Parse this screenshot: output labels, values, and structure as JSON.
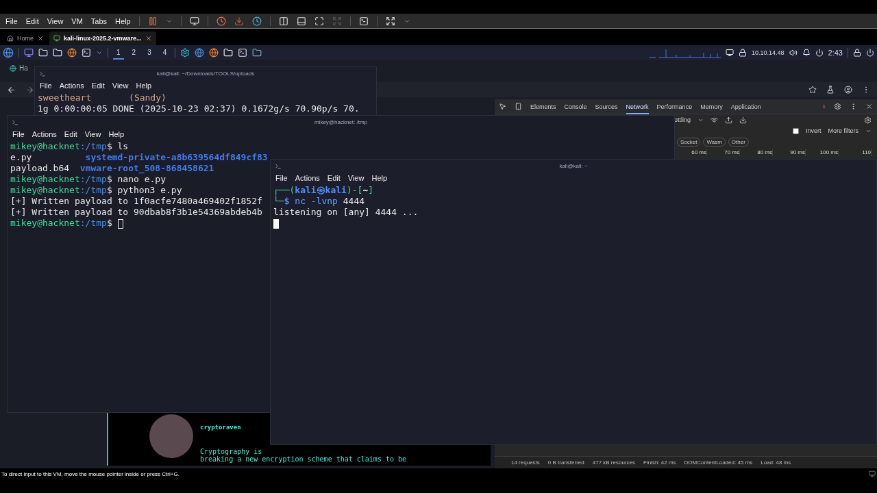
{
  "vm_menu": [
    "File",
    "Edit",
    "View",
    "VM",
    "Tabs",
    "Help"
  ],
  "vm_tabs": [
    {
      "label": "Home",
      "selected": false
    },
    {
      "label": "kali-linux-2025.2-vmware...",
      "selected": true
    }
  ],
  "panel": {
    "workspaces": [
      {
        "label": "1",
        "selected": true
      },
      {
        "label": "2",
        "selected": false
      },
      {
        "label": "3",
        "selected": false
      },
      {
        "label": "4",
        "selected": false
      }
    ],
    "ip": "10.10.14.48",
    "clock": "2:43"
  },
  "browser": {
    "tab": "Ha"
  },
  "devtools": {
    "tabs": [
      {
        "label": "Elements",
        "selected": false
      },
      {
        "label": "Console",
        "selected": false
      },
      {
        "label": "Sources",
        "selected": false
      },
      {
        "label": "Network",
        "selected": true
      },
      {
        "label": "Performance",
        "selected": false
      },
      {
        "label": "Memory",
        "selected": false
      },
      {
        "label": "Application",
        "selected": false
      }
    ],
    "error_count": "1",
    "throttling": "ottling",
    "invert": {
      "label": "Invert",
      "checked": false
    },
    "more_filters": "More filters",
    "filters": [
      "Socket",
      "Wasm",
      "Other"
    ],
    "ticks": [
      "60 ms",
      "70 ms",
      "80 ms",
      "90 ms",
      "100 ms",
      "110"
    ],
    "summary": [
      "14 requests",
      "0 B transferred",
      "477 kB resources",
      "Finish: 42 ms",
      "DOMContentLoaded: 45 ms",
      "Load: 48 ms"
    ]
  },
  "post": {
    "author": "cryptoraven",
    "lines": [
      "Cryptography is",
      "breaking a new encryption scheme that claims to be"
    ]
  },
  "terminals": [
    {
      "title": "kali@kali: ~/Downloads/TOOLS/uploads",
      "menu": [
        "File",
        "Actions",
        "Edit",
        "View",
        "Help"
      ],
      "lines": [
        [
          {
            "text": "sweetheart       (Sandy)",
            "kind": "warm"
          }
        ],
        [
          {
            "text": "1g 0:00:00:05 DONE (2025-10-23 02:37) 0.1672g/s 70.90p/s 70.",
            "kind": "plain"
          }
        ]
      ]
    },
    {
      "title": "mikey@hacknet: /tmp",
      "menu": [
        "File",
        "Actions",
        "Edit",
        "View",
        "Help"
      ],
      "lines": [
        [
          {
            "text": "mikey@hacknet",
            "kind": "user"
          },
          {
            "text": ":/tmp",
            "kind": "path"
          },
          {
            "text": "$ ls",
            "kind": "plain"
          }
        ],
        [
          {
            "text": "e.py          ",
            "kind": "plain"
          },
          {
            "text": "systemd-private-a8b639564df849cf83",
            "kind": "dir"
          }
        ],
        [
          {
            "text": "payload.b64  ",
            "kind": "plain"
          },
          {
            "text": "vmware-root_508-868458621",
            "kind": "dir"
          }
        ],
        [
          {
            "text": "mikey@hacknet",
            "kind": "user"
          },
          {
            "text": ":/tmp",
            "kind": "path"
          },
          {
            "text": "$ nano e.py",
            "kind": "plain"
          }
        ],
        [
          {
            "text": "mikey@hacknet",
            "kind": "user"
          },
          {
            "text": ":/tmp",
            "kind": "path"
          },
          {
            "text": "$ python3 e.py",
            "kind": "plain"
          }
        ],
        [
          {
            "text": "[+] Written payload to 1f0acfe7480a469402f1852f",
            "kind": "plain"
          }
        ],
        [
          {
            "text": "[+] Written payload to 90dbab8f3b1e54369abdeb4b",
            "kind": "plain"
          }
        ],
        [
          {
            "text": "mikey@hacknet",
            "kind": "user"
          },
          {
            "text": ":/tmp",
            "kind": "path"
          },
          {
            "text": "$ ",
            "kind": "plain"
          },
          {
            "kind": "cursor"
          }
        ]
      ]
    },
    {
      "title": "kali@kali: ~",
      "menu": [
        "File",
        "Actions",
        "Edit",
        "View",
        "Help"
      ],
      "lines": [
        [
          {
            "text": "┌──(",
            "kind": "frame"
          },
          {
            "text": "kali㉿kali",
            "kind": "host"
          },
          {
            "text": ")-[",
            "kind": "frame"
          },
          {
            "text": "~",
            "kind": "bold"
          },
          {
            "text": "]",
            "kind": "frame"
          }
        ],
        [
          {
            "text": "└─",
            "kind": "frame"
          },
          {
            "text": "$",
            "kind": "host"
          },
          {
            "text": " nc -lvnp ",
            "kind": "cmd"
          },
          {
            "text": "4444",
            "kind": "plain"
          }
        ],
        [
          {
            "text": "listening on [any] 4444 ...",
            "kind": "plain"
          }
        ],
        [
          {
            "kind": "block"
          }
        ]
      ]
    }
  ],
  "vm_status": "To direct input to this VM, move the mouse pointer inside or press Ctrl+G."
}
